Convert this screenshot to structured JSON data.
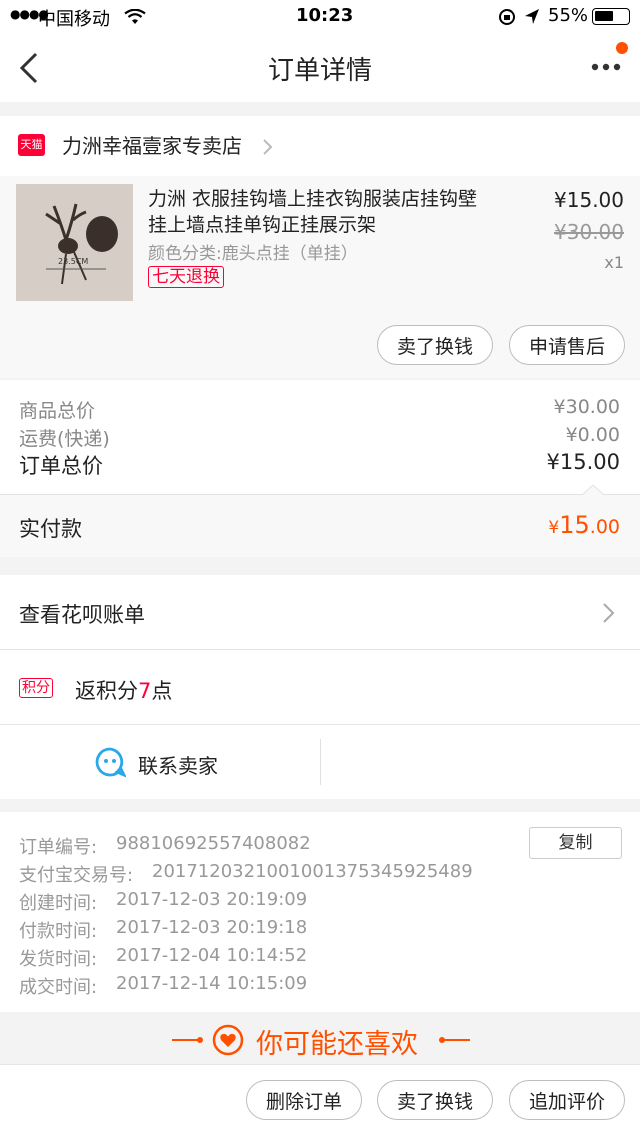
{
  "status_bar": {
    "signal": "●●●●",
    "carrier": "中国移动",
    "time": "10:23",
    "battery_pct": "55%"
  },
  "nav": {
    "title": "订单详情",
    "back_icon": "back-chevron-icon",
    "more_icon": "more-dots-icon",
    "notif_dot_color": "#ff5000"
  },
  "shop": {
    "badge": "天猫",
    "name": "力洲幸福壹家专卖店",
    "badge_color": "#ff0036"
  },
  "product": {
    "title_line1": "力洲 衣服挂钩墙上挂衣钩服装店挂钩壁",
    "title_line2": "挂上墙点挂单钩正挂展示架",
    "sku": "颜色分类:鹿头点挂（单挂）",
    "return_tag": "七天退换",
    "price": "¥15.00",
    "original_price": "¥30.00",
    "quantity": "x1",
    "image_caption": "23.5CM"
  },
  "item_actions": {
    "sell": "卖了换钱",
    "after_sale": "申请售后"
  },
  "summary": {
    "goods_label": "商品总价",
    "goods_value": "¥30.00",
    "shipping_label": "运费(快递)",
    "shipping_value": "¥0.00",
    "order_total_label": "订单总价",
    "order_total_value": "¥15.00",
    "paid_label": "实付款",
    "paid_currency": "¥",
    "paid_int": "15",
    "paid_dec": ".00"
  },
  "huabei": {
    "label": "查看花呗账单"
  },
  "points": {
    "badge": "积分",
    "prefix": "返积分",
    "value": "7",
    "suffix": "点"
  },
  "contact": {
    "label": "联系卖家"
  },
  "order_info": {
    "copy_btn": "复制",
    "rows": [
      {
        "label": "订单编号:",
        "value": "98810692557408082"
      },
      {
        "label": "支付宝交易号:",
        "value": "2017120321001001375345925489"
      },
      {
        "label": "创建时间:",
        "value": "2017-12-03 20:19:09"
      },
      {
        "label": "付款时间:",
        "value": "2017-12-03 20:19:18"
      },
      {
        "label": "发货时间:",
        "value": "2017-12-04 10:14:52"
      },
      {
        "label": "成交时间:",
        "value": "2017-12-14 10:15:09"
      }
    ]
  },
  "recommend": {
    "title": "你可能还喜欢",
    "color": "#ff5000"
  },
  "bottom_actions": {
    "delete": "删除订单",
    "sell": "卖了换钱",
    "review": "追加评价"
  }
}
